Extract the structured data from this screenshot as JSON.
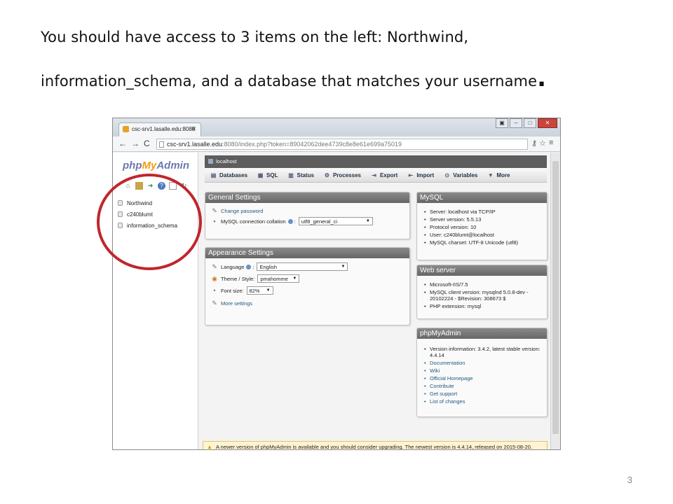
{
  "slide": {
    "line1": "You should have access to 3 items on the left: Northwind,",
    "line2": "information_schema,  and a database that matches your username",
    "period": ".",
    "page_number": "3"
  },
  "browser": {
    "tab_title": "csc-srv1.lasalle.edu:8080",
    "url_host": "csc-srv1.lasalle.edu",
    "url_rest": ":8080/index.php?token=89042062dee4739c8e8e61e699a75019"
  },
  "sidebar": {
    "logo_php": "php",
    "logo_my": "My",
    "logo_admin": "Admin",
    "databases": [
      "Northwind",
      "c240blumt",
      "information_schema"
    ]
  },
  "server_bar": {
    "label": "localhost"
  },
  "menu": {
    "items": [
      "Databases",
      "SQL",
      "Status",
      "Processes",
      "Export",
      "Import",
      "Variables",
      "More"
    ]
  },
  "general_settings": {
    "title": "General Settings",
    "change_password": "Change password",
    "collation_label": "MySQL connection collation",
    "collation_value": "utf8_general_ci"
  },
  "appearance_settings": {
    "title": "Appearance Settings",
    "language_label": "Language",
    "language_value": "English",
    "theme_label": "Theme / Style:",
    "theme_value": "pmahomme",
    "font_label": "Font size:",
    "font_value": "82%",
    "more_settings": "More settings"
  },
  "mysql": {
    "title": "MySQL",
    "items": [
      "Server: localhost via TCP/IP",
      "Server version: 5.5.13",
      "Protocol version: 10",
      "User: c240blumt@localhost",
      "MySQL charset: UTF-8 Unicode (utf8)"
    ]
  },
  "web_server": {
    "title": "Web server",
    "items": [
      "Microsoft-IIS/7.5",
      "MySQL client version: mysqlnd 5.0.8-dev - 20102224 - $Revision: 308673 $",
      "PHP extension: mysql"
    ]
  },
  "phpmyadmin": {
    "title": "phpMyAdmin",
    "version": "Version information: 3.4.2, latest stable version: 4.4.14",
    "links": [
      "Documentation",
      "Wiki",
      "Official Homepage",
      "Contribute",
      "Get support",
      "List of changes"
    ]
  },
  "notice": {
    "text": "A newer version of phpMyAdmin is available and you should consider upgrading. The newest version is 4.4.14, released on 2015-08-20."
  },
  "colors": {
    "annotation_oval": "#c0262c",
    "panel_header": "#666666",
    "link": "#235a81"
  }
}
